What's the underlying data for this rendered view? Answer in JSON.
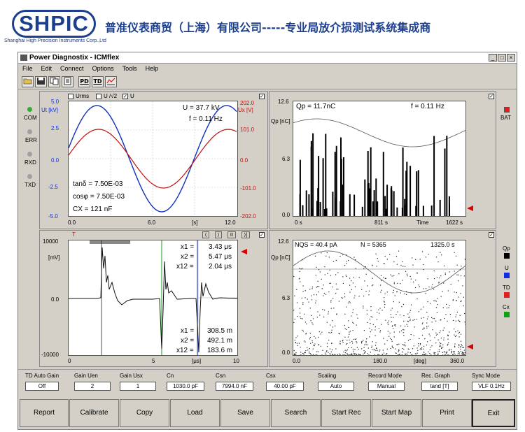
{
  "header": {
    "logo": "SHPIC",
    "logo_sub": "Shanghai High Precision Instruments Corp.,Ltd",
    "banner": "普准仪表商贸（上海）有限公司-----专业局放介损测试系统集成商"
  },
  "window": {
    "title": "Power Diagnostix - ICMflex",
    "controls": [
      "_",
      "□",
      "×"
    ]
  },
  "menu": [
    "File",
    "Edit",
    "Connect",
    "Options",
    "Tools",
    "Help"
  ],
  "toolbar": [
    "open",
    "save",
    "copy",
    "print",
    "PD",
    "TD",
    "scale"
  ],
  "toolbar_labels": {
    "pd": "PD",
    "td": "TD"
  },
  "status_leds": [
    {
      "label": "COM",
      "color": "#2fae2f"
    },
    {
      "label": "ERR",
      "color": "#a0a0a0"
    },
    {
      "label": "RXD",
      "color": "#a0a0a0"
    },
    {
      "label": "TXD",
      "color": "#a0a0a0"
    }
  ],
  "bat": {
    "label": "BAT",
    "color": "#e02020"
  },
  "signals": [
    {
      "label": "Qp",
      "color": "#000000"
    },
    {
      "label": "U",
      "color": "#1030e0"
    },
    {
      "label": "TD",
      "color": "#e02020"
    },
    {
      "label": "Cx",
      "color": "#10a010"
    }
  ],
  "panel_tl": {
    "checks": [
      "Urms",
      "U /√2",
      "U"
    ],
    "yleft_label": "Ut [kV]",
    "yright_label": "Ux [V]",
    "left_ticks": [
      "5.0",
      "2.5",
      "0.0",
      "-2.5",
      "-5.0"
    ],
    "right_ticks": [
      "202.0",
      "101.0",
      "0.0",
      "-101.0",
      "-202.0"
    ],
    "x_ticks": [
      "0.0",
      "6.0",
      "[s]",
      "12.0"
    ],
    "u_readout": "U = 37.7 kV",
    "f_readout": "f = 0.11 Hz",
    "tan": "tanδ = 7.50E-03",
    "cos": "cosφ = 7.50E-03",
    "cx": "CX = 121 nF"
  },
  "panel_tr": {
    "ylabel": "Qp [nC]",
    "y_ticks": [
      "12.6",
      "6.3",
      "0.0"
    ],
    "x_ticks": [
      "0 s",
      "811 s",
      "Time",
      "1622 s"
    ],
    "qp_readout": "Qp = 11.7nC",
    "f_readout": "f = 0.11 Hz"
  },
  "panel_bl": {
    "ylabel": "[mV]",
    "y_ticks": [
      "10000",
      "0.0",
      "-10000"
    ],
    "x_ticks": [
      "0",
      "5",
      "[μs]",
      "10"
    ],
    "top": {
      "x1": "3.43 μs",
      "x2": "5.47 μs",
      "x12": "2.04 μs"
    },
    "bottom": {
      "x1": "308.5 m",
      "x2": "492.1 m",
      "x12": "183.6 m"
    },
    "nav": [
      "⟨",
      "⟩",
      "II",
      "⟩|"
    ]
  },
  "panel_br": {
    "ylabel": "Qp [nC]",
    "y_ticks": [
      "12.6",
      "6.3",
      "0.0"
    ],
    "x_ticks": [
      "0.0",
      "180.0",
      "[deg]",
      "360.0"
    ],
    "nqs": "NQS = 40.4 pA",
    "n": "N = 5365",
    "time": "1325.0 s"
  },
  "settings": [
    {
      "label": "TD Auto Gain",
      "value": "Off"
    },
    {
      "label": "Gain Uen",
      "value": "2"
    },
    {
      "label": "Gain Usx",
      "value": "1"
    },
    {
      "label": "Cn",
      "value": "1030.0 pF"
    },
    {
      "label": "Csn",
      "value": "7994.0 nF"
    },
    {
      "label": "Csx",
      "value": "40.00 pF"
    },
    {
      "label": "Scaling",
      "value": "Auto"
    },
    {
      "label": "Record Mode",
      "value": "Manual"
    },
    {
      "label": "Rec. Graph",
      "value": "tand [T]"
    },
    {
      "label": "Sync Mode",
      "value": "VLF 0.1Hz"
    }
  ],
  "buttons": [
    "Report",
    "Calibrate",
    "Copy",
    "Load",
    "Save",
    "Search",
    "Start Rec",
    "Start Map",
    "Print",
    "Exit"
  ]
}
